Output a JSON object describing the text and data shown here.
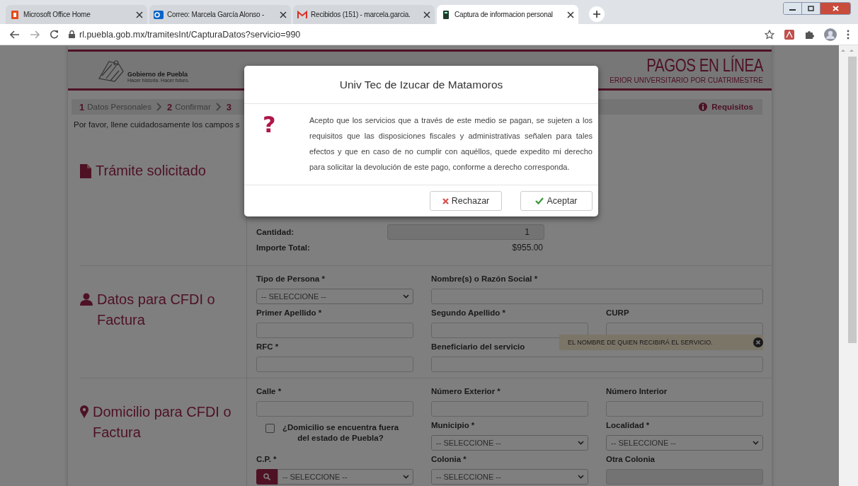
{
  "browser": {
    "tabs": [
      {
        "title": "Microsoft Office Home",
        "selected": false
      },
      {
        "title": "Correo: Marcela García Alonso -",
        "selected": false
      },
      {
        "title": "Recibidos (151) - marcela.garcia.",
        "selected": false
      },
      {
        "title": "Captura de informacion personal",
        "selected": true
      }
    ],
    "url": "rl.puebla.gob.mx/tramitesInt/CapturaDatos?servicio=990"
  },
  "header": {
    "org": "Gobierno de Puebla",
    "tagline": "Hacer historia. Hacer futuro.",
    "title": "PAGOS EN LÍNEA",
    "subtitle": "ERIOR UNIVERSITARIO POR CUATRIMESTRE"
  },
  "steps": [
    {
      "number": "1",
      "label": "Datos Personales"
    },
    {
      "number": "2",
      "label": "Confirmar"
    },
    {
      "number": "3"
    }
  ],
  "requirements": "Requisitos",
  "instructions": "Por favor, llene cuidadosamente los campos s",
  "sections": [
    {
      "kind": "summary",
      "title": "Trámite solicitado",
      "rows": [
        {
          "label": "Cantidad:",
          "value": "1",
          "kind": "input",
          "disabled": true
        },
        {
          "label": "Importe Total:",
          "value": "$955.00",
          "kind": "text"
        }
      ]
    },
    {
      "kind": "form",
      "title": "Datos para CFDI o Factura",
      "fields": [
        {
          "label": "Tipo de Persona *",
          "kind": "select",
          "value": "-- SELECCIONE --"
        },
        {
          "label": "Nombre(s) o Razón Social *",
          "kind": "input",
          "wide": true
        },
        {
          "label": "Primer Apellido *",
          "kind": "input"
        },
        {
          "label": "Segundo Apellido *",
          "kind": "input"
        },
        {
          "label": "CURP",
          "kind": "input"
        },
        {
          "label": "RFC *",
          "kind": "input"
        },
        {
          "label": "Beneficiario del servicio",
          "kind": "input",
          "wide": true,
          "tooltip": "EL NOMBRE DE QUIEN RECIBIRÁ EL SERVICIO."
        }
      ]
    },
    {
      "kind": "address",
      "title": "Domicilio para CFDI o Factura",
      "fields": [
        {
          "label": "Calle *",
          "kind": "input"
        },
        {
          "label": "Número Exterior *",
          "kind": "input"
        },
        {
          "label": "Número Interior",
          "kind": "input"
        },
        {
          "label": "¿Domicilio se encuentra fuera del estado de Puebla?",
          "kind": "checkbox",
          "checked": false
        },
        {
          "label": "Municipio *",
          "kind": "select",
          "value": "-- SELECCIONE --"
        },
        {
          "label": "Localidad *",
          "kind": "select",
          "value": "-- SELECCIONE --"
        },
        {
          "label": "C.P. *",
          "kind": "search-select",
          "value": "-- SELECCIONE --"
        },
        {
          "label": "Colonia *",
          "kind": "select",
          "value": "-- SELECCIONE --"
        },
        {
          "label": "Otra Colonia",
          "kind": "input",
          "disabled": true
        }
      ]
    }
  ],
  "modal": {
    "title": "Univ Tec de Izucar de Matamoros",
    "icon": "?",
    "message": "Acepto que los servicios que a través de este medio se pagan, se sujeten a los requisitos que las disposiciones fiscales y administrativas señalen para tales efectos y que en caso de no cumplir con aquéllos, quede expedito mi derecho para solicitar la devolución de este pago, conforme a derecho corresponda.",
    "buttons": [
      {
        "label": "Rechazar",
        "kind": "reject"
      },
      {
        "label": "Aceptar",
        "kind": "accept"
      }
    ]
  }
}
